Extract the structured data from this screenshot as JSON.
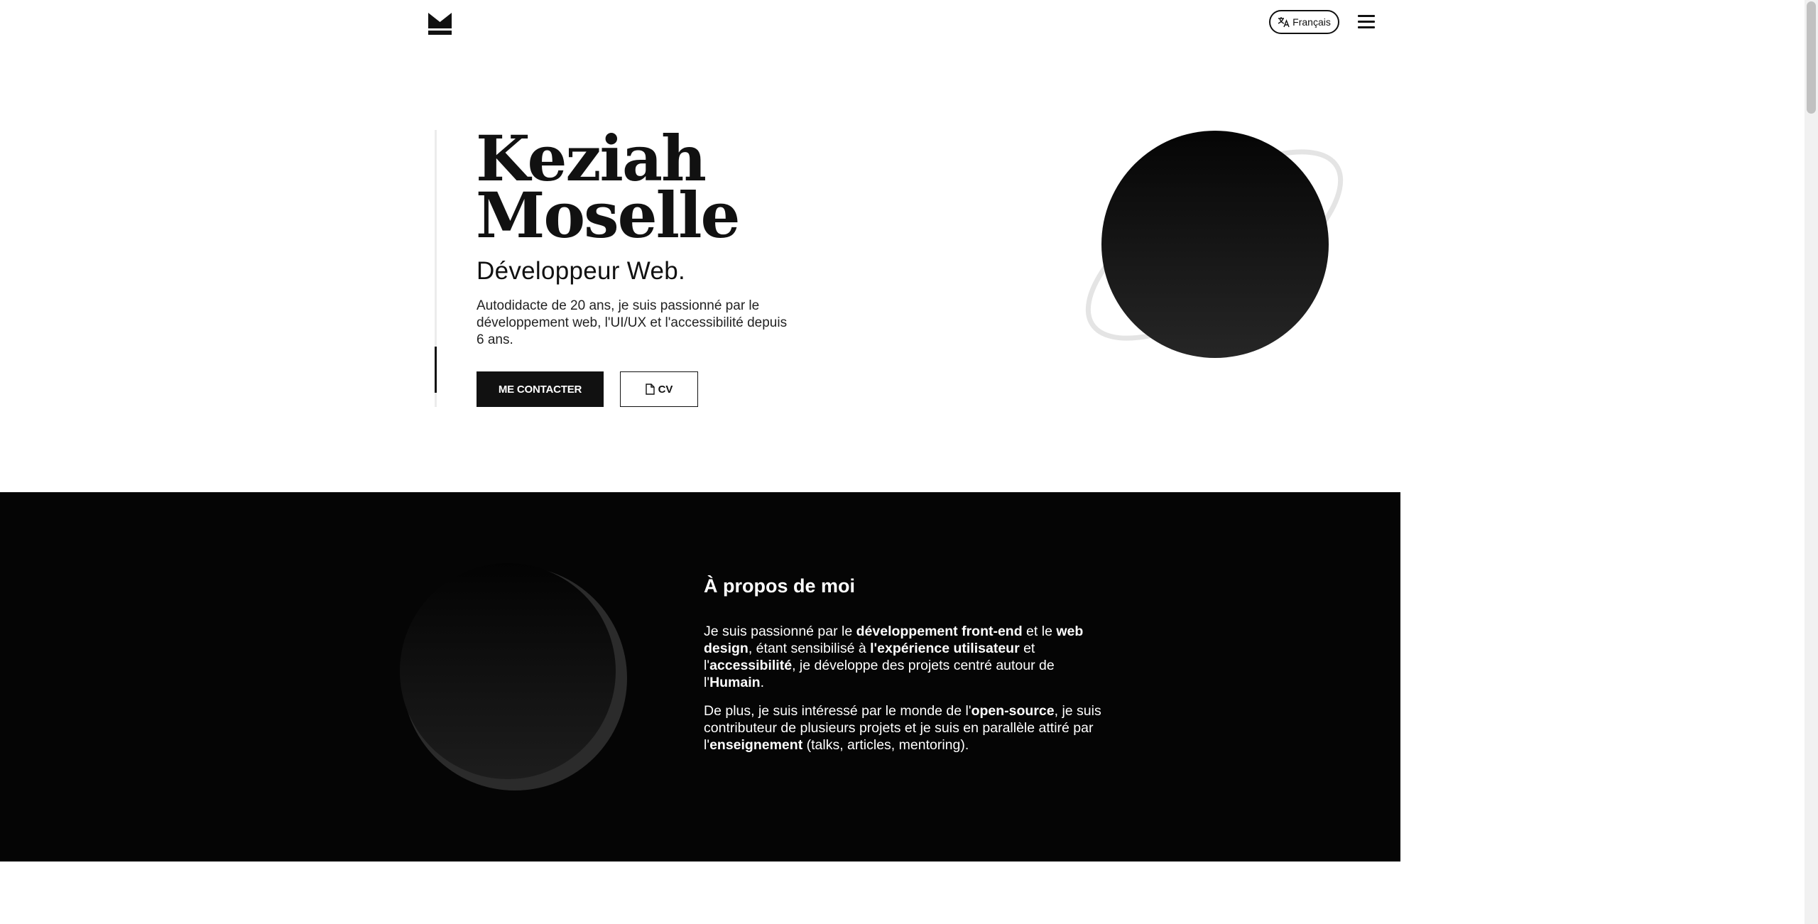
{
  "header": {
    "logo_icon": "logo-m-icon",
    "language_label": "Français",
    "language_icon": "translate-icon",
    "menu_icon": "hamburger-menu-icon"
  },
  "hero": {
    "name_line1": "Keziah",
    "name_line2": "Moselle",
    "role": "Développeur Web.",
    "description": "Autodidacte de 20 ans, je suis passionné par le développement web, l'UI/UX et l'accessibilité depuis 6 ans.",
    "contact_button": "ME CONTACTER",
    "cv_button": "CV",
    "cv_icon": "document-icon"
  },
  "about": {
    "title": "À propos de moi",
    "p1": {
      "t1": "Je suis passionné par le ",
      "b1": "développement front-end",
      "t2": " et le ",
      "b2": "web design",
      "t3": ", étant sensibilisé à ",
      "b3": "l'expérience utilisateur",
      "t4": " et l'",
      "b4": "accessibilité",
      "t5": ", je développe des projets centré autour de l'",
      "b5": "Humain",
      "t6": "."
    },
    "p2": {
      "t1": "De plus, je suis intéressé par le monde de l'",
      "b1": "open-source",
      "t2": ", je suis contributeur de plusieurs projets et je suis en parallèle attiré par l'",
      "b2": "enseignement",
      "t3": " (talks, articles, mentoring)."
    }
  },
  "colors": {
    "text": "#111111",
    "dark_section": "#050505",
    "ring": "#e6e6e6"
  }
}
